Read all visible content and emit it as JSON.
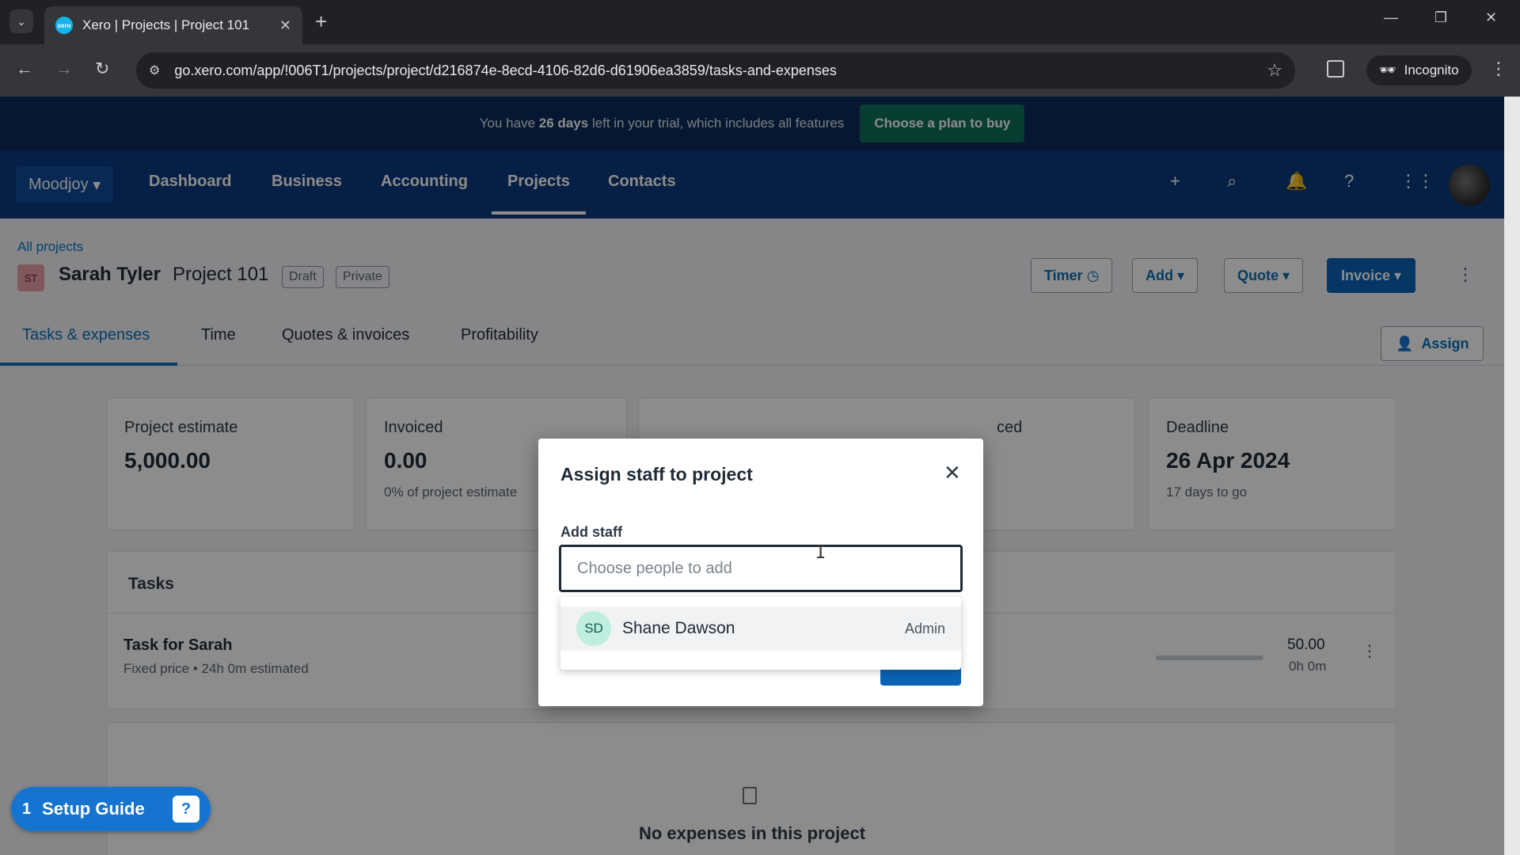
{
  "browser": {
    "tab_title": "Xero | Projects | Project 101",
    "favicon_text": "xero",
    "url": "go.xero.com/app/!006T1/projects/project/d216874e-8ecd-4106-82d6-d61906ea3859/tasks-and-expenses",
    "incognito_label": "Incognito"
  },
  "trial": {
    "text_prefix": "You have ",
    "days": "26 days",
    "text_suffix": " left in your trial, which includes all features",
    "cta": "Choose a plan to buy"
  },
  "nav": {
    "org": "Moodjoy",
    "links": [
      "Dashboard",
      "Business",
      "Accounting",
      "Projects",
      "Contacts"
    ],
    "active": "Projects"
  },
  "project": {
    "breadcrumb": "All projects",
    "contact_initials": "ST",
    "contact_name": "Sarah Tyler",
    "project_name": "Project 101",
    "badges": [
      "Draft",
      "Private"
    ],
    "actions": {
      "timer": "Timer",
      "add": "Add",
      "quote": "Quote",
      "invoice": "Invoice"
    }
  },
  "tabs": [
    "Tasks & expenses",
    "Time",
    "Quotes & invoices",
    "Profitability"
  ],
  "assign_label": "Assign",
  "cards": [
    {
      "label": "Project estimate",
      "value": "5,000.00"
    },
    {
      "label": "Invoiced",
      "value": "0.00",
      "sub": "0% of project estimate"
    },
    {
      "label": "ced"
    },
    {
      "label": "Deadline",
      "value": "26 Apr 2024",
      "sub": "17 days to go"
    }
  ],
  "tasks": {
    "title": "Tasks",
    "items": [
      {
        "name": "Task for Sarah",
        "meta": "Fixed price • 24h 0m estimated",
        "amount": "50.00",
        "time": "0h 0m"
      }
    ]
  },
  "expenses_empty": "No expenses in this project",
  "setup_guide": {
    "count": "1",
    "label": "Setup Guide"
  },
  "modal": {
    "title": "Assign staff to project",
    "field_label": "Add staff",
    "placeholder": "Choose people to add",
    "options": [
      {
        "initials": "SD",
        "name": "Shane Dawson",
        "role": "Admin"
      }
    ]
  },
  "colors": {
    "trial_bg": "#0a2b59",
    "nav_bg": "#0b3a7c",
    "accent_blue": "#0b63b5",
    "trial_cta": "#10725a",
    "option_avatar": "#bfeee0"
  }
}
